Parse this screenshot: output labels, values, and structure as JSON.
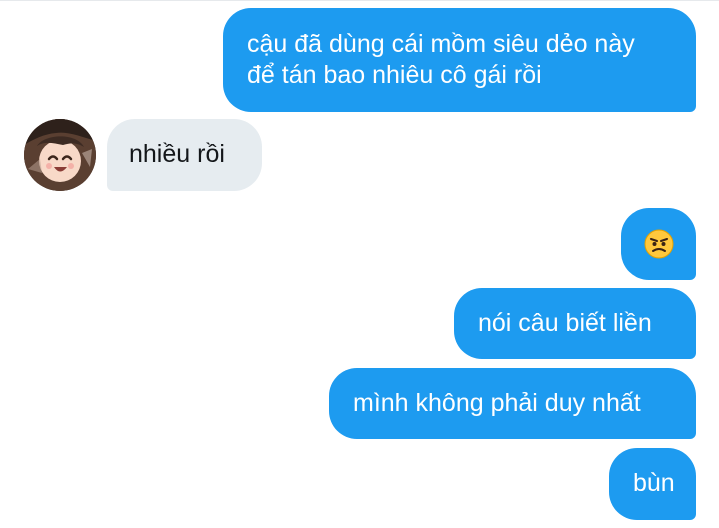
{
  "conversation": {
    "messages": [
      {
        "sender": "me",
        "lines": [
          "cậu đã dùng cái mồm siêu dẻo này",
          "để tán bao nhiêu cô gái rồi"
        ]
      },
      {
        "sender": "other",
        "lines": [
          "nhiều rồi"
        ]
      },
      {
        "sender": "me",
        "emoji": "angry-face-icon"
      },
      {
        "sender": "me",
        "lines": [
          "nói câu biết liền"
        ]
      },
      {
        "sender": "me",
        "lines": [
          "mình không phải duy nhất"
        ]
      },
      {
        "sender": "me",
        "lines": [
          "bùn"
        ]
      }
    ]
  },
  "colors": {
    "sent_bubble": "#1d9bf0",
    "received_bubble": "#e6ecf0",
    "sent_text": "#ffffff",
    "received_text": "#14171a",
    "angry_emoji": "#ffc83d"
  }
}
